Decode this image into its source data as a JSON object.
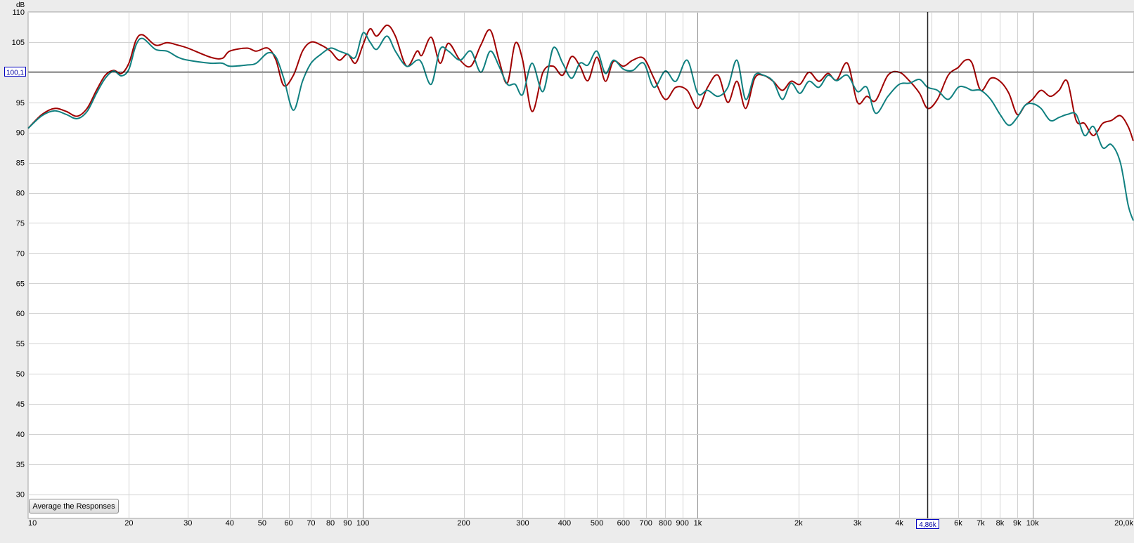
{
  "chart_data": {
    "type": "line",
    "xscale": "log",
    "xlim": [
      10,
      20000
    ],
    "ylim": [
      26,
      110
    ],
    "ylabel": "dB",
    "x_ticks": [
      {
        "value": 10,
        "label": "10"
      },
      {
        "value": 20,
        "label": "20"
      },
      {
        "value": 30,
        "label": "30"
      },
      {
        "value": 40,
        "label": "40"
      },
      {
        "value": 50,
        "label": "50"
      },
      {
        "value": 60,
        "label": "60"
      },
      {
        "value": 70,
        "label": "70"
      },
      {
        "value": 80,
        "label": "80"
      },
      {
        "value": 90,
        "label": "90"
      },
      {
        "value": 100,
        "label": "100"
      },
      {
        "value": 200,
        "label": "200"
      },
      {
        "value": 300,
        "label": "300"
      },
      {
        "value": 400,
        "label": "400"
      },
      {
        "value": 500,
        "label": "500"
      },
      {
        "value": 600,
        "label": "600"
      },
      {
        "value": 700,
        "label": "700"
      },
      {
        "value": 800,
        "label": "800"
      },
      {
        "value": 900,
        "label": "900"
      },
      {
        "value": 1000,
        "label": "1k"
      },
      {
        "value": 2000,
        "label": "2k"
      },
      {
        "value": 3000,
        "label": "3k"
      },
      {
        "value": 4000,
        "label": "4k"
      },
      {
        "value": 6000,
        "label": "6k"
      },
      {
        "value": 7000,
        "label": "7k"
      },
      {
        "value": 8000,
        "label": "8k"
      },
      {
        "value": 9000,
        "label": "9k"
      },
      {
        "value": 10000,
        "label": "10k"
      },
      {
        "value": 20000,
        "label": "20,0k"
      }
    ],
    "y_ticks": [
      110,
      105,
      95,
      90,
      85,
      80,
      75,
      70,
      65,
      60,
      55,
      50,
      45,
      40,
      35,
      30
    ],
    "grid": true,
    "cursor": {
      "x": 4860,
      "x_label": "4,86k",
      "y": 100.1,
      "y_label": "100,1"
    },
    "series": [
      {
        "color": "#a00000",
        "x": [
          10,
          11,
          12,
          13,
          14,
          15,
          16,
          17,
          18,
          19,
          20,
          21,
          22,
          24,
          26,
          28,
          30,
          35,
          38,
          40,
          45,
          48,
          52,
          55,
          58,
          62,
          66,
          70,
          75,
          80,
          85,
          90,
          95,
          100,
          105,
          110,
          118,
          125,
          135,
          145,
          150,
          160,
          170,
          180,
          195,
          210,
          225,
          240,
          255,
          270,
          285,
          300,
          320,
          345,
          370,
          395,
          420,
          445,
          470,
          500,
          530,
          560,
          600,
          640,
          690,
          740,
          800,
          860,
          930,
          1000,
          1070,
          1150,
          1230,
          1310,
          1390,
          1480,
          1570,
          1680,
          1790,
          1900,
          2020,
          2150,
          2300,
          2450,
          2600,
          2800,
          3000,
          3200,
          3400,
          3700,
          4000,
          4300,
          4600,
          4860,
          5200,
          5600,
          6000,
          6300,
          6600,
          7000,
          7500,
          8000,
          8500,
          9000,
          9500,
          10000,
          10600,
          11300,
          12000,
          12700,
          13500,
          14300,
          15200,
          16200,
          17200,
          18300,
          19300,
          20000
        ],
        "y": [
          90.7,
          93.0,
          94.0,
          93.5,
          92.7,
          94.0,
          97.0,
          99.5,
          100.3,
          99.8,
          101.5,
          105.3,
          106.2,
          104.5,
          104.9,
          104.5,
          104.0,
          102.5,
          102.3,
          103.5,
          104.0,
          103.5,
          104.0,
          102.0,
          97.8,
          99.5,
          103.5,
          105.0,
          104.5,
          103.5,
          102.0,
          103.0,
          101.5,
          104.5,
          107.2,
          106.0,
          107.8,
          106.0,
          101.0,
          103.5,
          102.8,
          105.8,
          101.5,
          104.8,
          102.0,
          101.0,
          104.5,
          107.0,
          102.0,
          98.2,
          104.8,
          102.0,
          93.5,
          100.0,
          101.0,
          99.5,
          102.6,
          101.0,
          98.6,
          102.5,
          98.5,
          101.8,
          101.0,
          102.0,
          102.3,
          99.0,
          95.5,
          97.5,
          97.0,
          94.0,
          97.5,
          99.5,
          95.0,
          98.5,
          94.0,
          99.0,
          99.5,
          98.5,
          97.0,
          98.5,
          98.0,
          100.0,
          98.5,
          99.8,
          98.7,
          101.5,
          95.0,
          96.0,
          95.3,
          99.5,
          100.0,
          98.5,
          96.5,
          94.0,
          95.5,
          99.5,
          100.8,
          102.0,
          101.5,
          97.0,
          99.0,
          98.5,
          96.5,
          93.0,
          94.5,
          95.5,
          97.0,
          96.0,
          97.0,
          98.5,
          92.0,
          91.5,
          89.5,
          91.5,
          92.0,
          92.8,
          91.0,
          88.6
        ]
      },
      {
        "color": "#108080",
        "x": [
          10,
          11,
          12,
          13,
          14,
          15,
          16,
          17,
          18,
          19,
          20,
          21,
          22,
          24,
          26,
          28,
          30,
          35,
          38,
          40,
          45,
          48,
          52,
          55,
          58,
          62,
          66,
          70,
          75,
          80,
          85,
          90,
          95,
          100,
          105,
          110,
          118,
          125,
          135,
          145,
          150,
          160,
          170,
          180,
          195,
          210,
          225,
          240,
          255,
          270,
          285,
          300,
          320,
          345,
          370,
          395,
          420,
          445,
          470,
          500,
          530,
          560,
          600,
          640,
          690,
          740,
          800,
          860,
          930,
          1000,
          1070,
          1150,
          1230,
          1310,
          1390,
          1480,
          1570,
          1680,
          1790,
          1900,
          2020,
          2150,
          2300,
          2450,
          2600,
          2800,
          3000,
          3200,
          3400,
          3700,
          4000,
          4300,
          4600,
          4860,
          5200,
          5600,
          6000,
          6300,
          6600,
          7000,
          7500,
          8000,
          8500,
          9000,
          9500,
          10000,
          10600,
          11300,
          12000,
          12700,
          13500,
          14300,
          15200,
          16200,
          17200,
          18300,
          19300,
          20000
        ],
        "y": [
          90.7,
          92.8,
          93.6,
          93.0,
          92.3,
          93.5,
          96.5,
          99.0,
          100.2,
          99.4,
          100.5,
          104.5,
          105.6,
          103.8,
          103.5,
          102.5,
          102.0,
          101.5,
          101.5,
          101.0,
          101.2,
          101.5,
          103.2,
          102.5,
          99.0,
          93.7,
          98.5,
          101.5,
          103.0,
          104.0,
          103.5,
          103.0,
          102.5,
          106.5,
          105.0,
          103.8,
          106.0,
          103.5,
          101.0,
          102.0,
          101.5,
          98.0,
          103.8,
          103.5,
          102.0,
          103.5,
          100.0,
          103.5,
          101.0,
          98.0,
          98.0,
          96.3,
          101.5,
          96.8,
          104.0,
          101.5,
          99.0,
          101.5,
          101.2,
          103.5,
          99.8,
          102.0,
          100.5,
          100.3,
          101.5,
          97.5,
          100.2,
          98.5,
          102.0,
          96.5,
          97.0,
          96.0,
          97.5,
          102.0,
          95.5,
          99.5,
          99.5,
          98.5,
          95.5,
          98.2,
          96.5,
          98.5,
          97.5,
          99.5,
          98.6,
          99.5,
          96.8,
          97.5,
          93.2,
          96.0,
          98.0,
          98.2,
          98.8,
          97.5,
          97.0,
          95.5,
          97.5,
          97.5,
          97.0,
          97.0,
          95.5,
          93.0,
          91.2,
          92.5,
          94.5,
          94.8,
          94.0,
          92.0,
          92.5,
          93.0,
          93.0,
          89.5,
          91.0,
          87.5,
          88.0,
          85.0,
          78.0,
          75.4
        ]
      }
    ]
  },
  "ui": {
    "average_button_label": "Average the Responses"
  }
}
